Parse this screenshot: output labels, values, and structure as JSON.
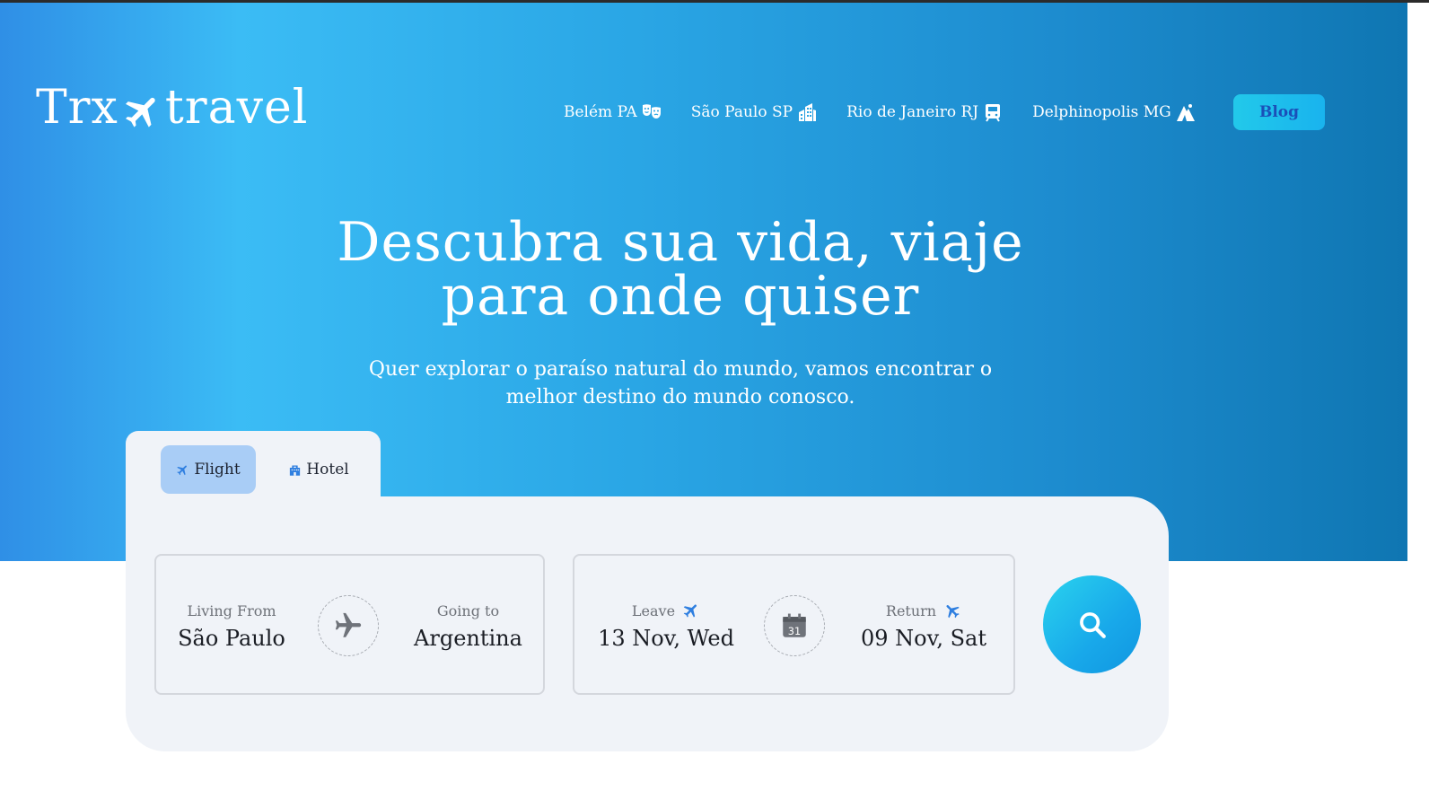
{
  "brand": {
    "left": "Trx",
    "right": "travel",
    "icon": "plane-icon"
  },
  "nav": {
    "items": [
      {
        "label": "Belém PA",
        "icon": "theater-masks-icon"
      },
      {
        "label": "São Paulo SP",
        "icon": "city-buildings-icon"
      },
      {
        "label": "Rio de Janeiro RJ",
        "icon": "train-icon"
      },
      {
        "label": "Delphinopolis MG",
        "icon": "mountain-icon"
      }
    ],
    "blog_label": "Blog"
  },
  "hero": {
    "headline_line1": "Descubra sua vida, viaje",
    "headline_line2": "para onde quiser",
    "subtitle_line1": "Quer explorar o paraíso natural do mundo, vamos encontrar o",
    "subtitle_line2": "melhor destino do mundo conosco."
  },
  "tabs": [
    {
      "label": "Flight",
      "icon": "plane-icon",
      "active": true
    },
    {
      "label": "Hotel",
      "icon": "hotel-icon",
      "active": false
    }
  ],
  "search": {
    "from_label": "Living From",
    "from_value": "São Paulo",
    "to_label": "Going to",
    "to_value": "Argentina",
    "leave_label": "Leave",
    "leave_value": "13 Nov, Wed",
    "return_label": "Return",
    "return_value": "09 Nov, Sat",
    "calendar_day": "31"
  },
  "colors": {
    "accent": "#1b4fb8",
    "tab_active": "#a9cdf6",
    "panel": "#f0f3f8",
    "icon_blue": "#2f7fe0"
  }
}
